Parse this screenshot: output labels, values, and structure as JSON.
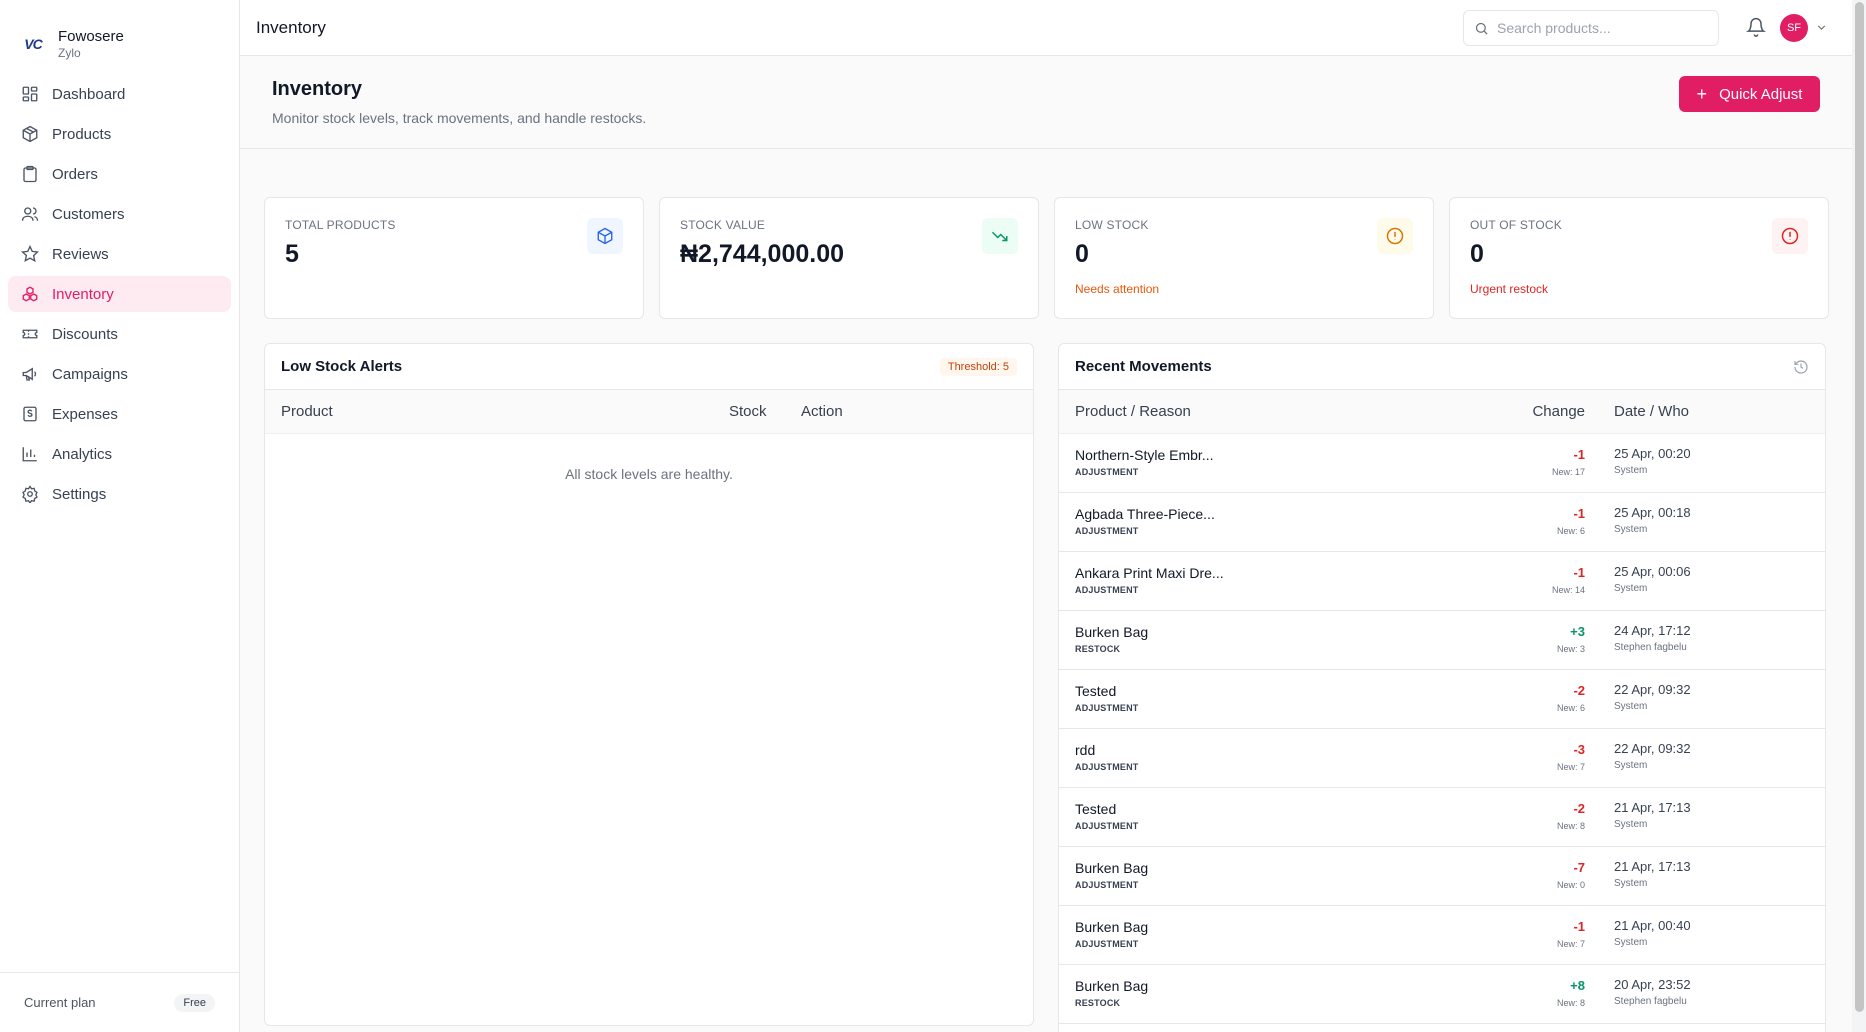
{
  "brand": {
    "logo": "VC",
    "name": "Fowosere",
    "sub": "Zylo"
  },
  "sidebar": {
    "items": [
      {
        "label": "Dashboard",
        "icon": "grid-icon"
      },
      {
        "label": "Products",
        "icon": "package-icon"
      },
      {
        "label": "Orders",
        "icon": "clipboard-icon"
      },
      {
        "label": "Customers",
        "icon": "users-icon"
      },
      {
        "label": "Reviews",
        "icon": "star-icon"
      },
      {
        "label": "Inventory",
        "icon": "boxes-icon"
      },
      {
        "label": "Discounts",
        "icon": "ticket-icon"
      },
      {
        "label": "Campaigns",
        "icon": "megaphone-icon"
      },
      {
        "label": "Expenses",
        "icon": "receipt-icon"
      },
      {
        "label": "Analytics",
        "icon": "bar-chart-icon"
      },
      {
        "label": "Settings",
        "icon": "gear-icon"
      }
    ],
    "active": "Inventory",
    "plan_label": "Current plan",
    "plan_badge": "Free"
  },
  "topbar": {
    "title": "Inventory",
    "search_placeholder": "Search products...",
    "avatar_initials": "SF"
  },
  "page": {
    "title": "Inventory",
    "subtitle": "Monitor stock levels, track movements, and handle restocks.",
    "quick_adjust_label": "Quick Adjust"
  },
  "stats": [
    {
      "label": "TOTAL PRODUCTS",
      "value": "5",
      "note": "",
      "icon": "cube-icon",
      "icon_color": "#2563eb",
      "icon_bg": "#eff6ff"
    },
    {
      "label": "STOCK VALUE",
      "value": "₦2,744,000.00",
      "note": "",
      "icon": "trending-down-icon",
      "icon_color": "#059669",
      "icon_bg": "#ecfdf5"
    },
    {
      "label": "LOW STOCK",
      "value": "0",
      "note": "Needs attention",
      "note_color": "#ea580c",
      "icon": "alert-circle-icon",
      "icon_color": "#d97706",
      "icon_bg": "#fffbeb"
    },
    {
      "label": "OUT OF STOCK",
      "value": "0",
      "note": "Urgent restock",
      "note_color": "#dc2626",
      "icon": "alert-circle-icon",
      "icon_color": "#dc2626",
      "icon_bg": "#fef2f2"
    }
  ],
  "low_stock": {
    "title": "Low Stock Alerts",
    "threshold": "Threshold: 5",
    "columns": [
      "Product",
      "Stock",
      "Action"
    ],
    "empty": "All stock levels are healthy."
  },
  "movements": {
    "title": "Recent Movements",
    "columns": [
      "Product / Reason",
      "Change",
      "Date / Who"
    ],
    "rows": [
      {
        "name": "Northern-Style Embr...",
        "reason": "ADJUSTMENT",
        "change": "-1",
        "new": "New: 17",
        "date": "25 Apr, 00:20",
        "who": "System"
      },
      {
        "name": "Agbada Three-Piece...",
        "reason": "ADJUSTMENT",
        "change": "-1",
        "new": "New: 6",
        "date": "25 Apr, 00:18",
        "who": "System"
      },
      {
        "name": "Ankara Print Maxi Dre...",
        "reason": "ADJUSTMENT",
        "change": "-1",
        "new": "New: 14",
        "date": "25 Apr, 00:06",
        "who": "System"
      },
      {
        "name": "Burken Bag",
        "reason": "RESTOCK",
        "change": "+3",
        "new": "New: 3",
        "date": "24 Apr, 17:12",
        "who": "Stephen fagbelu"
      },
      {
        "name": "Tested",
        "reason": "ADJUSTMENT",
        "change": "-2",
        "new": "New: 6",
        "date": "22 Apr, 09:32",
        "who": "System"
      },
      {
        "name": "rdd",
        "reason": "ADJUSTMENT",
        "change": "-3",
        "new": "New: 7",
        "date": "22 Apr, 09:32",
        "who": "System"
      },
      {
        "name": "Tested",
        "reason": "ADJUSTMENT",
        "change": "-2",
        "new": "New: 8",
        "date": "21 Apr, 17:13",
        "who": "System"
      },
      {
        "name": "Burken Bag",
        "reason": "ADJUSTMENT",
        "change": "-7",
        "new": "New: 0",
        "date": "21 Apr, 17:13",
        "who": "System"
      },
      {
        "name": "Burken Bag",
        "reason": "ADJUSTMENT",
        "change": "-1",
        "new": "New: 7",
        "date": "21 Apr, 00:40",
        "who": "System"
      },
      {
        "name": "Burken Bag",
        "reason": "RESTOCK",
        "change": "+8",
        "new": "New: 8",
        "date": "20 Apr, 23:52",
        "who": "Stephen fagbelu"
      }
    ]
  }
}
